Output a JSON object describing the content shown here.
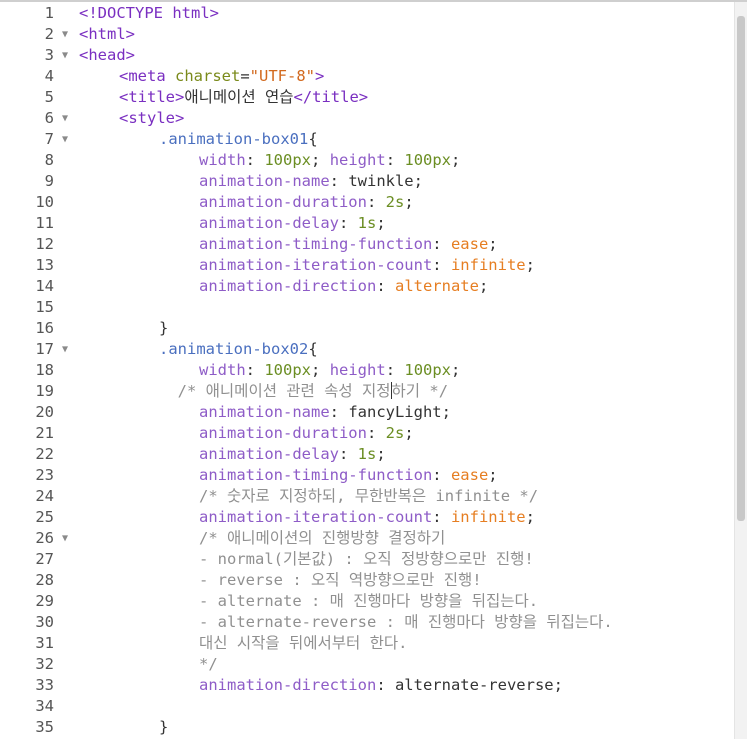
{
  "editor": {
    "lines": [
      {
        "n": "1",
        "fold": false,
        "indent": 0,
        "tokens": [
          [
            "tag",
            "<!DOCTYPE html>"
          ]
        ]
      },
      {
        "n": "2",
        "fold": true,
        "indent": 0,
        "tokens": [
          [
            "tag",
            "<html>"
          ]
        ]
      },
      {
        "n": "3",
        "fold": true,
        "indent": 0,
        "tokens": [
          [
            "tag",
            "<head>"
          ]
        ]
      },
      {
        "n": "4",
        "fold": false,
        "indent": 1,
        "tokens": [
          [
            "tag",
            "<meta "
          ],
          [
            "attr",
            "charset"
          ],
          [
            "plain",
            "="
          ],
          [
            "str",
            "\"UTF-8\""
          ],
          [
            "tag",
            ">"
          ]
        ]
      },
      {
        "n": "5",
        "fold": false,
        "indent": 1,
        "tokens": [
          [
            "tag",
            "<title>"
          ],
          [
            "plain",
            "애니메이션 연습"
          ],
          [
            "tag",
            "</title>"
          ]
        ]
      },
      {
        "n": "6",
        "fold": true,
        "indent": 1,
        "tokens": [
          [
            "tag",
            "<style>"
          ]
        ]
      },
      {
        "n": "7",
        "fold": true,
        "indent": 2,
        "tokens": [
          [
            "sel",
            ".animation-box01"
          ],
          [
            "plain",
            "{"
          ]
        ]
      },
      {
        "n": "8",
        "fold": false,
        "indent": 3,
        "tokens": [
          [
            "prop",
            "width"
          ],
          [
            "plain",
            ": "
          ],
          [
            "num",
            "100px"
          ],
          [
            "plain",
            "; "
          ],
          [
            "prop",
            "height"
          ],
          [
            "plain",
            ": "
          ],
          [
            "num",
            "100px"
          ],
          [
            "plain",
            ";"
          ]
        ]
      },
      {
        "n": "9",
        "fold": false,
        "indent": 3,
        "tokens": [
          [
            "prop",
            "animation-name"
          ],
          [
            "plain",
            ": twinkle;"
          ]
        ]
      },
      {
        "n": "10",
        "fold": false,
        "indent": 3,
        "tokens": [
          [
            "prop",
            "animation-duration"
          ],
          [
            "plain",
            ": "
          ],
          [
            "num",
            "2s"
          ],
          [
            "plain",
            ";"
          ]
        ]
      },
      {
        "n": "11",
        "fold": false,
        "indent": 3,
        "tokens": [
          [
            "prop",
            "animation-delay"
          ],
          [
            "plain",
            ": "
          ],
          [
            "num",
            "1s"
          ],
          [
            "plain",
            ";"
          ]
        ]
      },
      {
        "n": "12",
        "fold": false,
        "indent": 3,
        "tokens": [
          [
            "prop",
            "animation-timing-function"
          ],
          [
            "plain",
            ": "
          ],
          [
            "kw",
            "ease"
          ],
          [
            "plain",
            ";"
          ]
        ]
      },
      {
        "n": "13",
        "fold": false,
        "indent": 3,
        "tokens": [
          [
            "prop",
            "animation-iteration-count"
          ],
          [
            "plain",
            ": "
          ],
          [
            "kw",
            "infinite"
          ],
          [
            "plain",
            ";"
          ]
        ]
      },
      {
        "n": "14",
        "fold": false,
        "indent": 3,
        "tokens": [
          [
            "prop",
            "animation-direction"
          ],
          [
            "plain",
            ": "
          ],
          [
            "kw",
            "alternate"
          ],
          [
            "plain",
            ";"
          ]
        ]
      },
      {
        "n": "15",
        "fold": false,
        "indent": 0,
        "tokens": []
      },
      {
        "n": "16",
        "fold": false,
        "indent": 2,
        "tokens": [
          [
            "plain",
            "}"
          ]
        ]
      },
      {
        "n": "17",
        "fold": true,
        "indent": 2,
        "tokens": [
          [
            "sel",
            ".animation-box02"
          ],
          [
            "plain",
            "{"
          ]
        ]
      },
      {
        "n": "18",
        "fold": false,
        "indent": 3,
        "tokens": [
          [
            "prop",
            "width"
          ],
          [
            "plain",
            ": "
          ],
          [
            "num",
            "100px"
          ],
          [
            "plain",
            "; "
          ],
          [
            "prop",
            "height"
          ],
          [
            "plain",
            ": "
          ],
          [
            "num",
            "100px"
          ],
          [
            "plain",
            ";"
          ]
        ]
      },
      {
        "n": "19",
        "fold": false,
        "indent": 2,
        "tokens": [
          [
            "plain",
            "  "
          ],
          [
            "cm",
            "/* 애니메이션 관련 속성 지정"
          ],
          [
            "cursor",
            ""
          ],
          [
            "cm",
            "하기 */"
          ]
        ]
      },
      {
        "n": "20",
        "fold": false,
        "indent": 3,
        "tokens": [
          [
            "prop",
            "animation-name"
          ],
          [
            "plain",
            ": fancyLight;"
          ]
        ]
      },
      {
        "n": "21",
        "fold": false,
        "indent": 3,
        "tokens": [
          [
            "prop",
            "animation-duration"
          ],
          [
            "plain",
            ": "
          ],
          [
            "num",
            "2s"
          ],
          [
            "plain",
            ";"
          ]
        ]
      },
      {
        "n": "22",
        "fold": false,
        "indent": 3,
        "tokens": [
          [
            "prop",
            "animation-delay"
          ],
          [
            "plain",
            ": "
          ],
          [
            "num",
            "1s"
          ],
          [
            "plain",
            ";"
          ]
        ]
      },
      {
        "n": "23",
        "fold": false,
        "indent": 3,
        "tokens": [
          [
            "prop",
            "animation-timing-function"
          ],
          [
            "plain",
            ": "
          ],
          [
            "kw",
            "ease"
          ],
          [
            "plain",
            ";"
          ]
        ]
      },
      {
        "n": "24",
        "fold": false,
        "indent": 3,
        "tokens": [
          [
            "cm",
            "/* 숫자로 지정하되, 무한반복은 infinite */"
          ]
        ]
      },
      {
        "n": "25",
        "fold": false,
        "indent": 3,
        "tokens": [
          [
            "prop",
            "animation-iteration-count"
          ],
          [
            "plain",
            ": "
          ],
          [
            "kw",
            "infinite"
          ],
          [
            "plain",
            ";"
          ]
        ]
      },
      {
        "n": "26",
        "fold": true,
        "indent": 3,
        "tokens": [
          [
            "cm",
            "/* 애니메이션의 진행방향 결정하기"
          ]
        ]
      },
      {
        "n": "27",
        "fold": false,
        "indent": 3,
        "tokens": [
          [
            "cm",
            "- normal(기본값) : 오직 정방향으로만 진행!"
          ]
        ]
      },
      {
        "n": "28",
        "fold": false,
        "indent": 3,
        "tokens": [
          [
            "cm",
            "- reverse : 오직 역방향으로만 진행!"
          ]
        ]
      },
      {
        "n": "29",
        "fold": false,
        "indent": 3,
        "tokens": [
          [
            "cm",
            "- alternate : 매 진행마다 방향을 뒤집는다."
          ]
        ]
      },
      {
        "n": "30",
        "fold": false,
        "indent": 3,
        "tokens": [
          [
            "cm",
            "- alternate-reverse : 매 진행마다 방향을 뒤집는다."
          ]
        ]
      },
      {
        "n": "31",
        "fold": false,
        "indent": 3,
        "tokens": [
          [
            "cm",
            "대신 시작을 뒤에서부터 한다."
          ]
        ]
      },
      {
        "n": "32",
        "fold": false,
        "indent": 3,
        "tokens": [
          [
            "cm",
            "*/"
          ]
        ]
      },
      {
        "n": "33",
        "fold": false,
        "indent": 3,
        "tokens": [
          [
            "prop",
            "animation-direction"
          ],
          [
            "plain",
            ": alternate-reverse;"
          ]
        ]
      },
      {
        "n": "34",
        "fold": false,
        "indent": 0,
        "tokens": []
      },
      {
        "n": "35",
        "fold": false,
        "indent": 2,
        "tokens": [
          [
            "plain",
            "}"
          ]
        ]
      }
    ],
    "fold_glyph": "▼",
    "colors": {
      "tag": "#7a2fc1",
      "attr": "#7a8a1a",
      "string": "#d2691e",
      "selector": "#4a6fbf",
      "property": "#8e5cc7",
      "number": "#6b8e23",
      "keyword": "#e67e22",
      "comment": "#909090",
      "plain": "#333333"
    }
  }
}
